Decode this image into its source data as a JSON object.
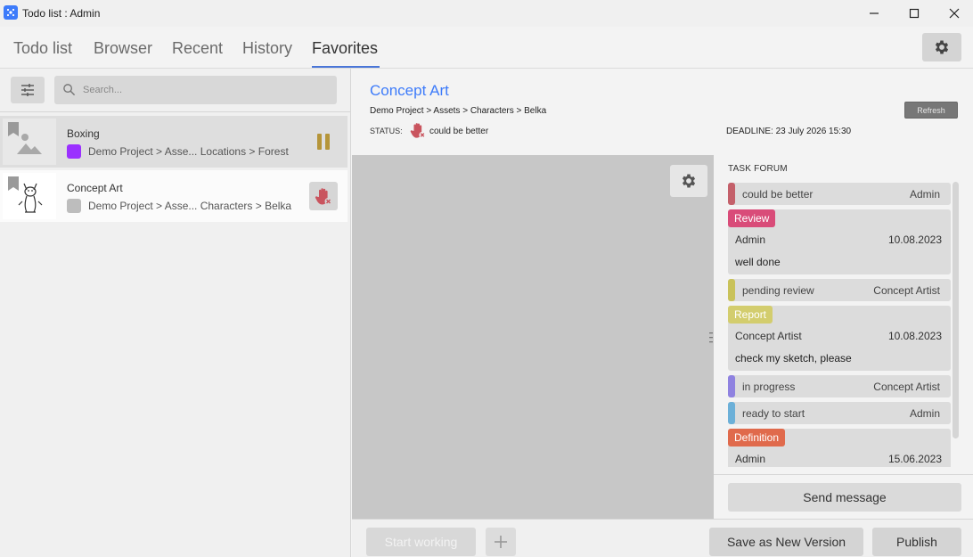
{
  "window": {
    "title": "Todo list : Admin"
  },
  "tabs": [
    {
      "label": "Todo list",
      "active": false
    },
    {
      "label": "Browser",
      "active": false
    },
    {
      "label": "Recent",
      "active": false
    },
    {
      "label": "History",
      "active": false
    },
    {
      "label": "Favorites",
      "active": true
    }
  ],
  "search": {
    "placeholder": "Search..."
  },
  "items": [
    {
      "name": "Boxing",
      "path": "Demo Project > Asse... Locations > Forest",
      "swatch": "#9b30ff",
      "status_icon": "pause-icon",
      "selected": true
    },
    {
      "name": "Concept Art",
      "path": "Demo Project > Asse... Characters > Belka",
      "swatch": "#bdbdbd",
      "status_icon": "stop-hand-icon",
      "selected": false
    }
  ],
  "detail": {
    "title": "Concept Art",
    "breadcrumb": "Demo Project > Assets > Characters > Belka",
    "refresh_label": "Refresh",
    "status_label": "STATUS:",
    "status_value": "could be better",
    "deadline": "DEADLINE: 23 July 2026 15:30"
  },
  "forum": {
    "title": "TASK FORUM",
    "messages": [
      {
        "kind": "status",
        "status": "could be better",
        "author": "Admin",
        "color": "#c4606a"
      },
      {
        "kind": "card",
        "tag": "Review",
        "tag_color": "#d94c79",
        "author": "Admin",
        "date": "10.08.2023",
        "text": "well done"
      },
      {
        "kind": "status",
        "status": "pending review",
        "author": "Concept Artist",
        "color": "#c9c25a"
      },
      {
        "kind": "card",
        "tag": "Report",
        "tag_color": "#d3cd6e",
        "author": "Concept Artist",
        "date": "10.08.2023",
        "text": "check my sketch, please"
      },
      {
        "kind": "status",
        "status": "in progress",
        "author": "Concept Artist",
        "color": "#8f82e0"
      },
      {
        "kind": "status",
        "status": "ready to start",
        "author": "Admin",
        "color": "#6cb0d8"
      },
      {
        "kind": "card",
        "tag": "Definition",
        "tag_color": "#e06a4c",
        "author": "Admin",
        "date": "15.06.2023",
        "text": ""
      }
    ],
    "send_label": "Send message"
  },
  "bottom": {
    "start_label": "Start working",
    "save_label": "Save as New Version",
    "publish_label": "Publish"
  },
  "colors": {
    "accent": "#3d7bfa",
    "stop_hand": "#c9545e",
    "pause": "#b5953a"
  }
}
